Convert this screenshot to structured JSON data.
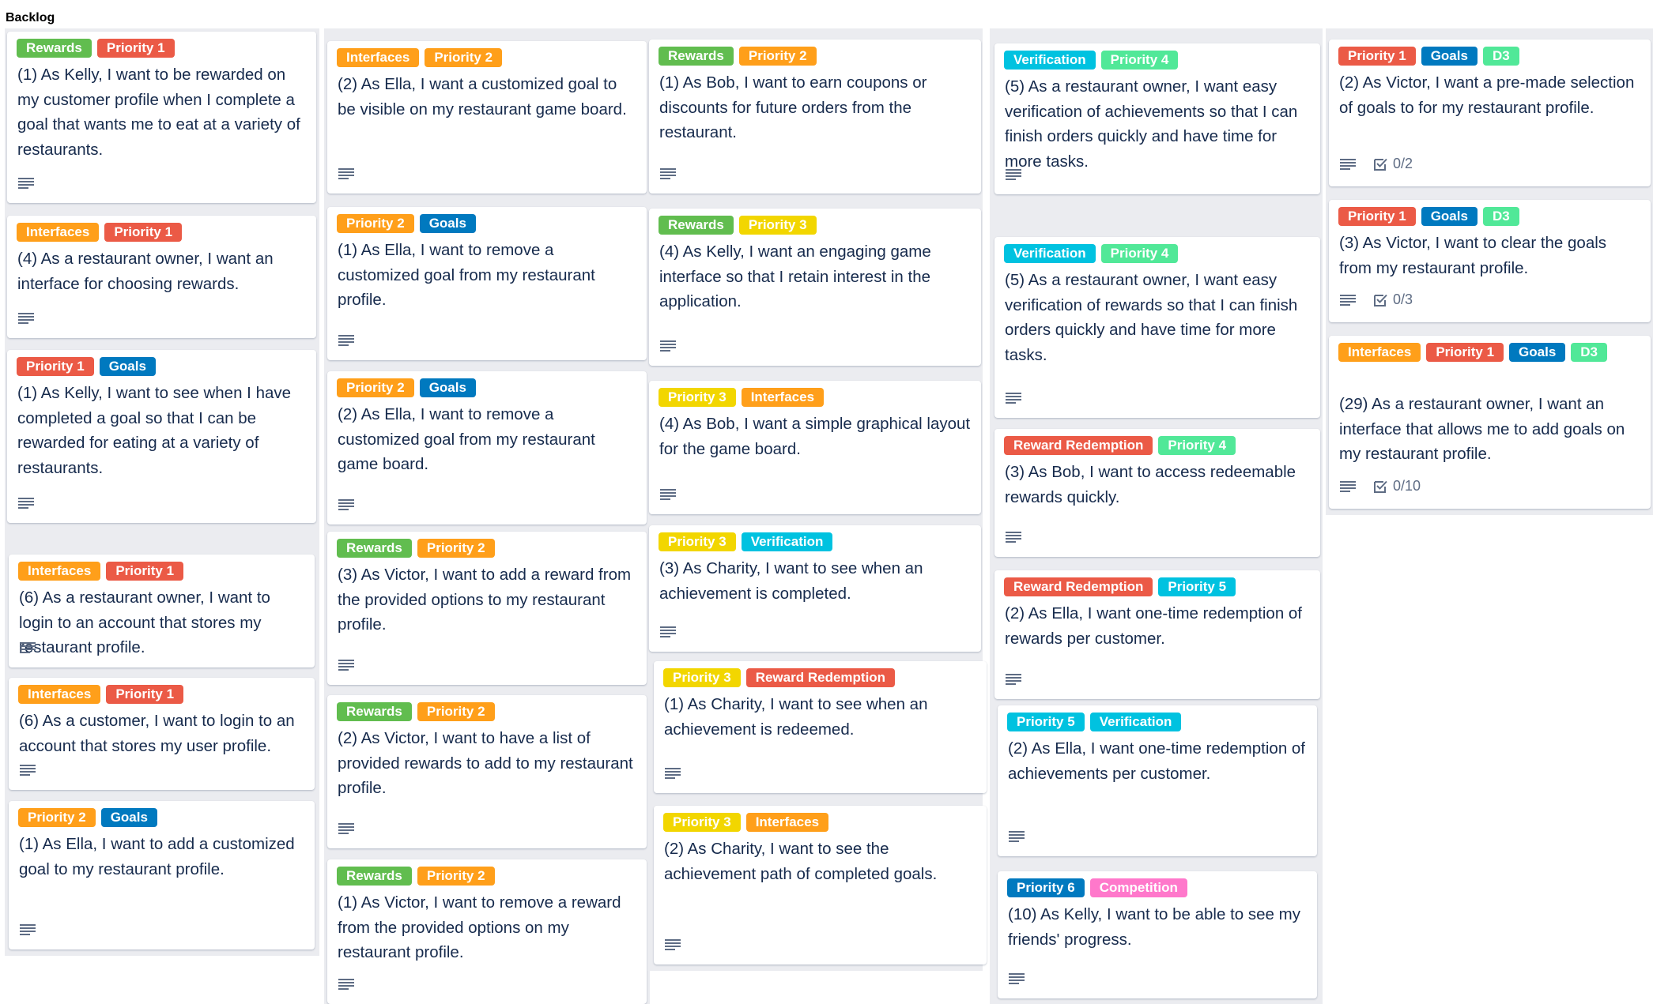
{
  "page": {
    "title": "Backlog"
  },
  "label_colors": {
    "Rewards": "#61bd4f",
    "Priority 1": "#eb5a46",
    "Priority 2": "#ff9f1a",
    "Priority 3": "#f2d600",
    "Priority 4": "#51e898",
    "Priority 5": "#00c2e0",
    "Priority 6": "#0079bf",
    "Interfaces": "#ff9f1a",
    "Goals": "#0079bf",
    "Verification": "#00c2e0",
    "Reward Redemption": "#eb5a46",
    "Competition": "#ff78cb",
    "D3": "#51e898"
  },
  "columns": [
    {
      "cards": [
        {
          "labels": [
            "Rewards",
            "Priority 1"
          ],
          "title": "(1) As Kelly, I want to be rewarded on my customer profile when I complete a goal that wants me to eat at a variety of restaurants."
        },
        {
          "labels": [
            "Interfaces",
            "Priority 1"
          ],
          "title": "(4) As a restaurant owner, I want an interface for choosing rewards."
        },
        {
          "labels": [
            "Priority 1",
            "Goals"
          ],
          "title": "(1) As Kelly, I want to see when I have completed a goal so that I can be rewarded for eating at a variety of restaurants."
        },
        {
          "labels": [
            "Interfaces",
            "Priority 1"
          ],
          "title": "(6) As a restaurant owner, I want to login to an account that stores my restaurant profile."
        },
        {
          "labels": [
            "Interfaces",
            "Priority 1"
          ],
          "title": "(6) As a customer, I want to login to an account that stores my user profile."
        },
        {
          "labels": [
            "Priority 2",
            "Goals"
          ],
          "title": "(1) As Ella, I want to add a customized goal to my restaurant profile."
        }
      ]
    },
    {
      "cards": [
        {
          "labels": [
            "Interfaces",
            "Priority 2"
          ],
          "title": "(2) As Ella, I want a customized goal to be visible on my restaurant game board."
        },
        {
          "labels": [
            "Priority 2",
            "Goals"
          ],
          "title": "(1) As Ella, I want to remove a customized goal from my restaurant profile."
        },
        {
          "labels": [
            "Priority 2",
            "Goals"
          ],
          "title": "(2) As Ella, I want to remove a customized goal from my restaurant game board."
        },
        {
          "labels": [
            "Rewards",
            "Priority 2"
          ],
          "title": "(3) As Victor, I want to add a reward from the provided options to my restaurant profile."
        },
        {
          "labels": [
            "Rewards",
            "Priority 2"
          ],
          "title": "(2) As Victor, I want to have a list of provided rewards to add to my restaurant profile."
        },
        {
          "labels": [
            "Rewards",
            "Priority 2"
          ],
          "title": "(1) As Victor, I want to remove a reward from the provided options on my restaurant profile."
        }
      ]
    },
    {
      "cards": [
        {
          "labels": [
            "Rewards",
            "Priority 2"
          ],
          "title": "(1) As Bob, I want to earn coupons or discounts for future orders from the restaurant."
        },
        {
          "labels": [
            "Rewards",
            "Priority 3"
          ],
          "title": "(4) As Kelly, I want an engaging game interface so that I retain interest in the application."
        },
        {
          "labels": [
            "Priority 3",
            "Interfaces"
          ],
          "title": "(4) As Bob, I want a simple graphical layout for the game board."
        },
        {
          "labels": [
            "Priority 3",
            "Verification"
          ],
          "title": "(3) As Charity, I want to see when an achievement is completed."
        },
        {
          "labels": [
            "Priority 3",
            "Reward Redemption"
          ],
          "title": "(1) As Charity, I want to see when an achievement is redeemed."
        },
        {
          "labels": [
            "Priority 3",
            "Interfaces"
          ],
          "title": "(2) As Charity, I want to see the achievement path of completed goals."
        }
      ]
    },
    {
      "cards": [
        {
          "labels": [
            "Verification",
            "Priority 4"
          ],
          "title": "(5) As a restaurant owner, I want easy verification of achievements so that I can finish orders quickly and have time for more tasks."
        },
        {
          "labels": [
            "Verification",
            "Priority 4"
          ],
          "title": "(5) As a restaurant owner, I want easy verification of rewards so that I can finish orders quickly and have time for more tasks."
        },
        {
          "labels": [
            "Reward Redemption",
            "Priority 4"
          ],
          "title": "(3) As Bob, I want to access redeemable rewards quickly."
        },
        {
          "labels": [
            "Reward Redemption",
            "Priority 5"
          ],
          "title": "(2) As Ella, I want one-time redemption of rewards per customer."
        },
        {
          "labels": [
            "Priority 5",
            "Verification"
          ],
          "title": "(2) As Ella, I want one-time redemption of achievements per customer."
        },
        {
          "labels": [
            "Priority 6",
            "Competition"
          ],
          "title": "(10) As Kelly, I want to be able to see my friends' progress."
        }
      ]
    },
    {
      "cards": [
        {
          "labels": [
            "Priority 1",
            "Goals",
            "D3"
          ],
          "title": "(2) As Victor, I want a pre-made selection of goals to for my restaurant profile.",
          "checklist": "0/2"
        },
        {
          "labels": [
            "Priority 1",
            "Goals",
            "D3"
          ],
          "title": "(3) As Victor, I want to clear the goals from my restaurant profile.",
          "checklist": "0/3"
        },
        {
          "labels": [
            "Interfaces",
            "Priority 1",
            "Goals",
            "D3"
          ],
          "title": "(29) As a restaurant owner, I want an interface that allows me to add goals on my restaurant profile.",
          "checklist": "0/10"
        }
      ]
    }
  ]
}
